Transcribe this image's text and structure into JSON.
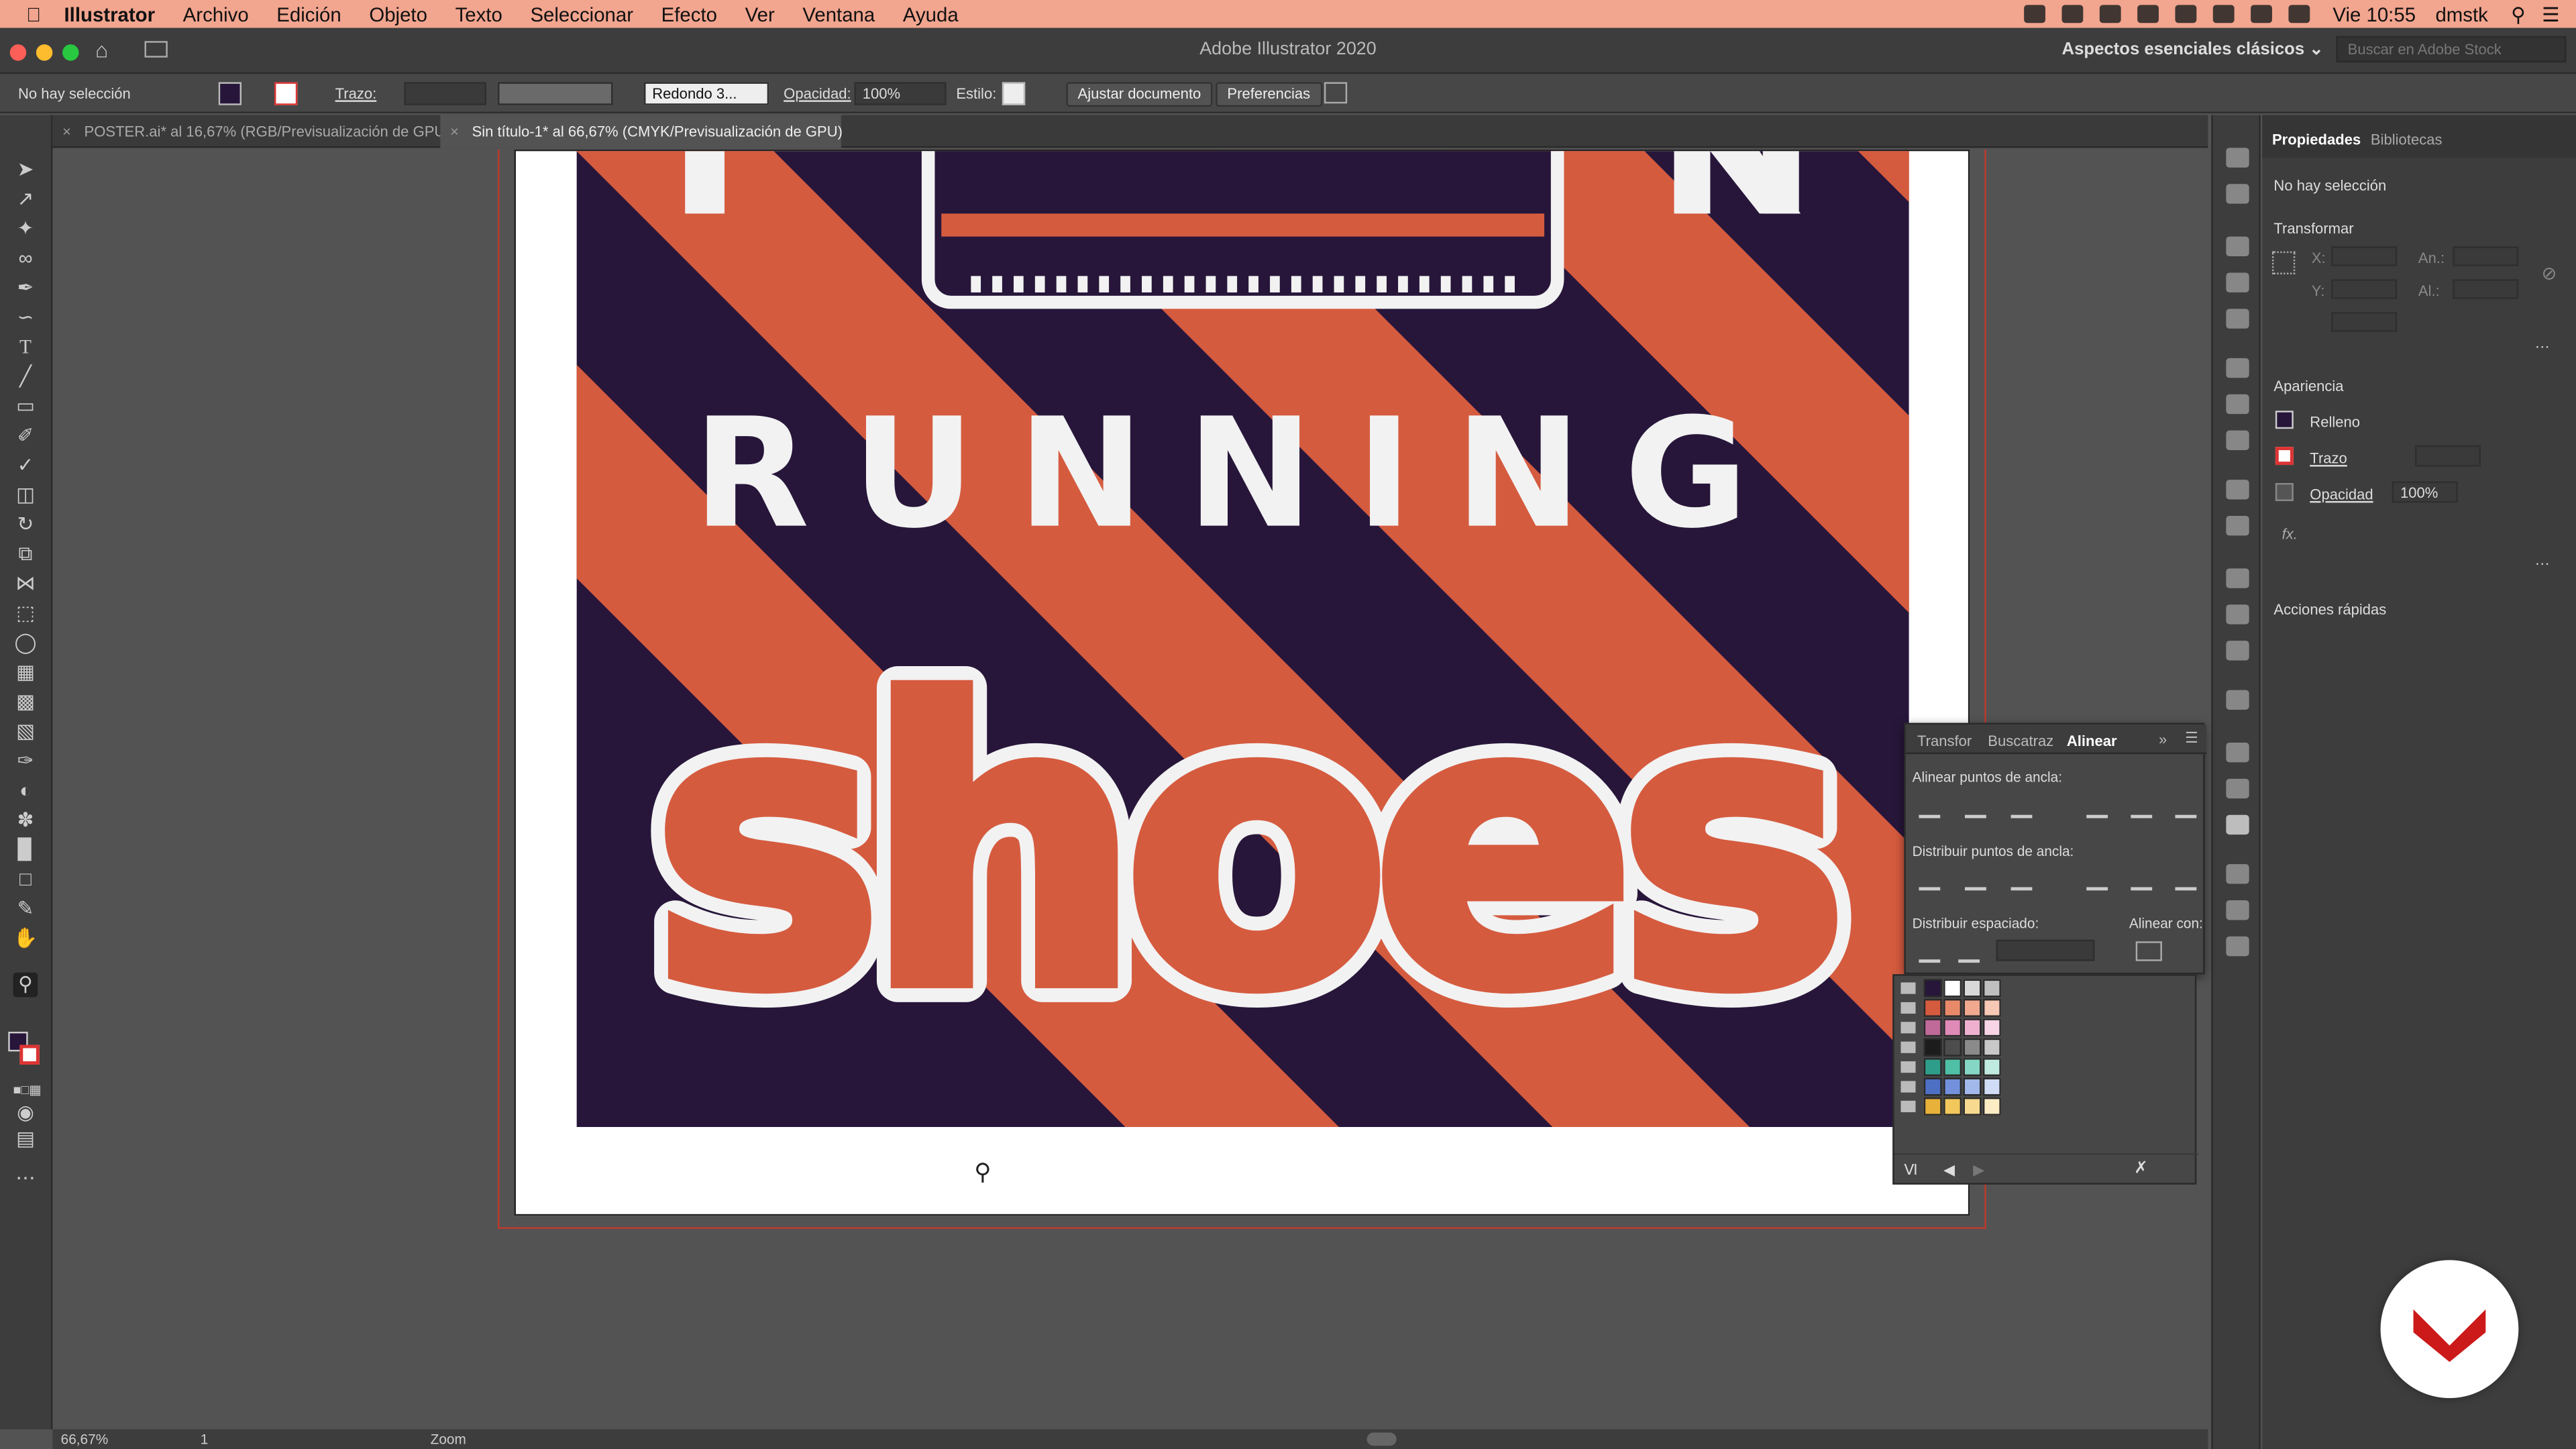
{
  "menubar": {
    "app": "Illustrator",
    "items": [
      "Archivo",
      "Edición",
      "Objeto",
      "Texto",
      "Seleccionar",
      "Efecto",
      "Ver",
      "Ventana",
      "Ayuda"
    ],
    "clock": "Vie 10:55",
    "user": "dmstk"
  },
  "window": {
    "title": "Adobe Illustrator 2020",
    "workspace": "Aspectos esenciales clásicos",
    "stock_placeholder": "Buscar en Adobe Stock"
  },
  "control": {
    "selection": "No hay selección",
    "stroke_label": "Trazo:",
    "brush": "Redondo 3...",
    "opacity_label": "Opacidad:",
    "opacity_value": "100%",
    "style_label": "Estilo:",
    "fit_document": "Ajustar documento",
    "preferences": "Preferencias"
  },
  "tabs": [
    {
      "label": "POSTER.ai* al 16,67% (RGB/Previsualización de GPU)",
      "active": false
    },
    {
      "label": "Sin título-1* al 66,67% (CMYK/Previsualización de GPU)",
      "active": true
    }
  ],
  "artwork": {
    "headline": "RUNNING",
    "word": "shoes",
    "colors": {
      "navy": "#27163a",
      "orange": "#d55b3f",
      "white": "#f2f2f2"
    }
  },
  "status": {
    "zoom": "66,67%",
    "artboard": "1",
    "tool": "Zoom"
  },
  "properties": {
    "tab_properties": "Propiedades",
    "tab_libraries": "Bibliotecas",
    "selection": "No hay selección",
    "transform": "Transformar",
    "x_label": "X:",
    "y_label": "Y:",
    "w_label": "An.:",
    "h_label": "Al.:",
    "appearance": "Apariencia",
    "fill": "Relleno",
    "stroke": "Trazo",
    "opacity": "Opacidad",
    "opacity_value": "100%",
    "fx": "fx.",
    "quick_actions": "Acciones rápidas"
  },
  "align_panel": {
    "tabs": [
      "Transfor",
      "Buscatraz",
      "Alinear"
    ],
    "anchor_align": "Alinear puntos de ancla:",
    "anchor_distribute": "Distribuir puntos de ancla:",
    "distribute_spacing": "Distribuir espaciado:",
    "align_to": "Alinear con:"
  },
  "swatches": [
    [
      "#27163a",
      "#ffffff",
      "#d9d9d9",
      "#bfbfbf"
    ],
    [
      "#d55b3f",
      "#e88a6a",
      "#f0a98f",
      "#f6c8b5"
    ],
    [
      "#c06a9a",
      "#e08ab8",
      "#efb0d0",
      "#f7d4e6"
    ],
    [
      "#1c1c1c",
      "#4d4d4d",
      "#8a8a8a",
      "#c8c8c8"
    ],
    [
      "#2e9e8a",
      "#4fbfa6",
      "#85d6c4",
      "#bfeadf"
    ],
    [
      "#4d6fc4",
      "#7290dc",
      "#a2b8ea",
      "#d0dcf5"
    ],
    [
      "#e8b23a",
      "#f2c85c",
      "#f7da90",
      "#fbecc4"
    ]
  ]
}
